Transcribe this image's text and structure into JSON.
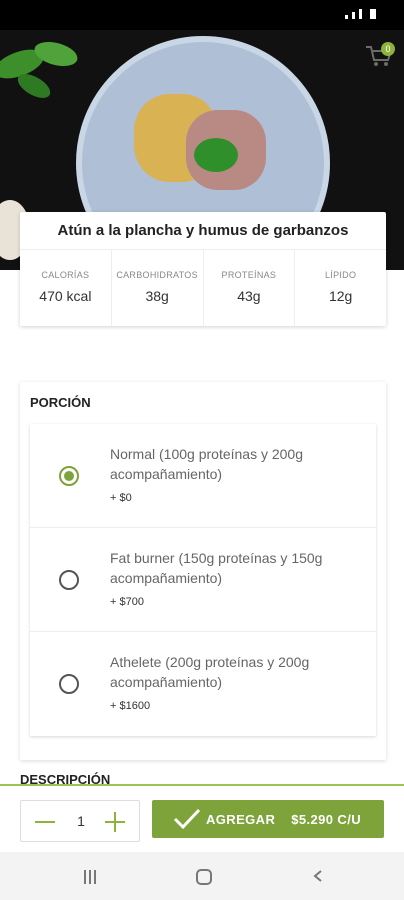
{
  "hero": {
    "cart_count": "0"
  },
  "dish": {
    "title": "Atún a la plancha y humus de garbanzos",
    "nutrients": [
      {
        "label": "CALORÍAS",
        "value": "470 kcal"
      },
      {
        "label": "CARBOHIDRATOS",
        "value": "38g"
      },
      {
        "label": "PROTEÍNAS",
        "value": "43g"
      },
      {
        "label": "LÍPIDO",
        "value": "12g"
      }
    ]
  },
  "portion": {
    "title": "PORCIÓN",
    "options": [
      {
        "label": "Normal (100g proteínas y 200g acompañamiento)",
        "price": "+ $0",
        "selected": true
      },
      {
        "label": "Fat burner (150g proteínas y 150g acompañamiento)",
        "price": "+ $700",
        "selected": false
      },
      {
        "label": "Athelete (200g proteínas y 200g acompañamiento)",
        "price": "+ $1600",
        "selected": false
      }
    ]
  },
  "description": {
    "heading": "DESCRIPCIÓN"
  },
  "footer": {
    "quantity": "1",
    "add_label": "AGREGAR",
    "add_price": "$5.290 C/U"
  },
  "colors": {
    "accent": "#7da33a",
    "background": "#ffffff"
  }
}
